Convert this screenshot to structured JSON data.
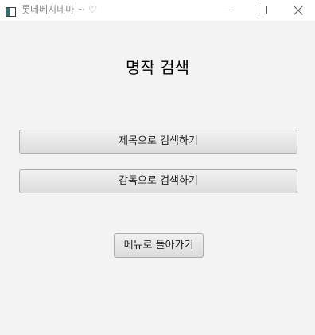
{
  "window": {
    "title": "롯데베시네마 ~ ♡",
    "controls": {
      "minimize_icon": "minimize-icon",
      "maximize_icon": "maximize-icon",
      "close_icon": "close-icon"
    }
  },
  "main": {
    "heading": "명작 검색",
    "search_by_title_label": "제목으로 검색하기",
    "search_by_director_label": "감독으로 검색하기",
    "back_to_menu_label": "메뉴로 돌아가기"
  },
  "colors": {
    "window_background": "#f3f3f3",
    "titlebar_background": "#ffffff",
    "title_text": "#8c8c8c",
    "button_border": "#adadad",
    "button_text": "#1f1f1f"
  }
}
